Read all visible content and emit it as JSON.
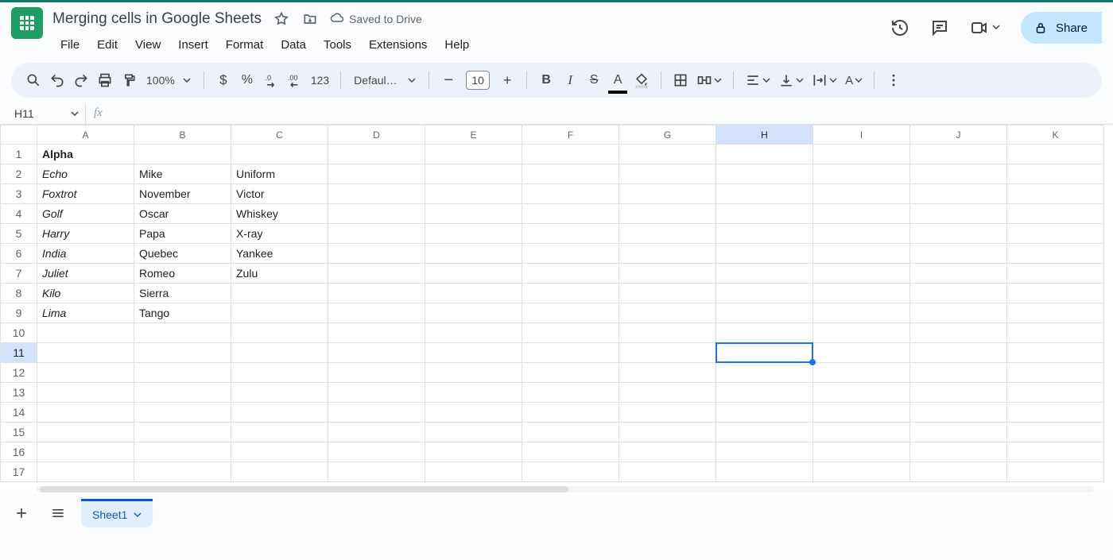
{
  "doc_title": "Merging cells in Google Sheets",
  "save_status": "Saved to Drive",
  "menus": [
    "File",
    "Edit",
    "View",
    "Insert",
    "Format",
    "Data",
    "Tools",
    "Extensions",
    "Help"
  ],
  "share_label": "Share",
  "toolbar": {
    "zoom": "100%",
    "font_name": "Defaul…",
    "font_size": "10",
    "number_format": "123"
  },
  "cell_ref": "H11",
  "formula": "",
  "columns": [
    "A",
    "B",
    "C",
    "D",
    "E",
    "F",
    "G",
    "H",
    "I",
    "J",
    "K"
  ],
  "selected_col_index": 7,
  "row_count": 17,
  "selected_row": 11,
  "selected_cell": "H11",
  "cells": {
    "1": {
      "A": "Alpha"
    },
    "2": {
      "A": "Echo",
      "B": "Mike",
      "C": "Uniform"
    },
    "3": {
      "A": "Foxtrot",
      "B": "November",
      "C": "Victor"
    },
    "4": {
      "A": "Golf",
      "B": "Oscar",
      "C": "Whiskey"
    },
    "5": {
      "A": "Harry",
      "B": "Papa",
      "C": "X-ray"
    },
    "6": {
      "A": "India",
      "B": "Quebec",
      "C": "Yankee"
    },
    "7": {
      "A": "Juliet",
      "B": "Romeo",
      "C": "Zulu"
    },
    "8": {
      "A": "Kilo",
      "B": "Sierra"
    },
    "9": {
      "A": "Lima",
      "B": "Tango"
    }
  },
  "sheet_tab": "Sheet1"
}
